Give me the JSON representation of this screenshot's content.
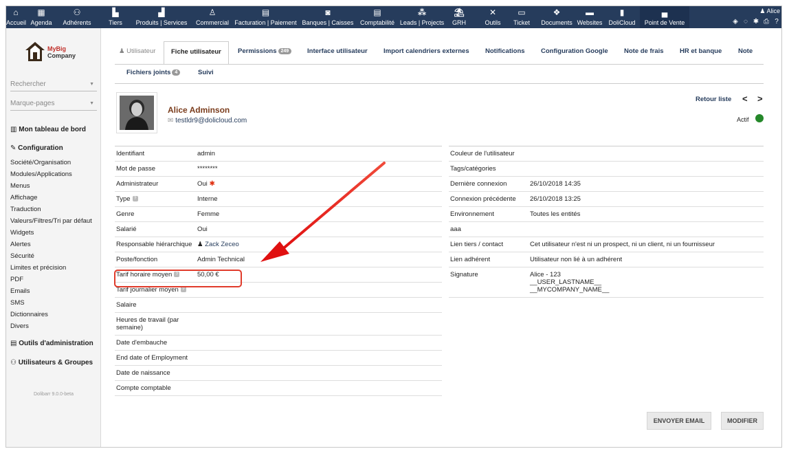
{
  "topmenu": [
    {
      "label": "Accueil",
      "icon": "home-icon"
    },
    {
      "label": "Agenda",
      "icon": "calendar-icon"
    },
    {
      "label": "Adhérents",
      "icon": "members-icon"
    },
    {
      "label": "Tiers",
      "icon": "companies-icon"
    },
    {
      "label": "Produits | Services",
      "icon": "products-icon"
    },
    {
      "label": "Commercial",
      "icon": "commercial-icon"
    },
    {
      "label": "Facturation | Paiement",
      "icon": "billing-icon"
    },
    {
      "label": "Banques | Caisses",
      "icon": "bank-icon"
    },
    {
      "label": "Comptabilité",
      "icon": "accounting-icon"
    },
    {
      "label": "Leads | Projects",
      "icon": "projects-icon"
    },
    {
      "label": "GRH",
      "icon": "hr-icon"
    },
    {
      "label": "Outils",
      "icon": "tools-icon"
    },
    {
      "label": "Ticket",
      "icon": "ticket-icon"
    },
    {
      "label": "Documents",
      "icon": "documents-icon"
    },
    {
      "label": "Websites",
      "icon": "websites-icon"
    },
    {
      "label": "DoliCloud",
      "icon": "dolicloud-icon"
    },
    {
      "label": "Point de Vente",
      "icon": "pos-icon"
    }
  ],
  "topright": {
    "user": "Alice"
  },
  "sidebar": {
    "logo_line1": "MyBig",
    "logo_line2": "Company",
    "search_placeholder": "Rechercher",
    "bookmarks_placeholder": "Marque-pages",
    "dashboard": "Mon tableau de bord",
    "config_title": "Configuration",
    "config_items": [
      "Société/Organisation",
      "Modules/Applications",
      "Menus",
      "Affichage",
      "Traduction",
      "Valeurs/Filtres/Tri par défaut",
      "Widgets",
      "Alertes",
      "Sécurité",
      "Limites et précision",
      "PDF",
      "Emails",
      "SMS",
      "Dictionnaires",
      "Divers"
    ],
    "admin_tools": "Outils d'administration",
    "users_groups": "Utilisateurs & Groupes",
    "version": "Dolibarr 9.0.0-beta"
  },
  "tabs": {
    "utilisateur": "Utilisateur",
    "fiche": "Fiche utilisateur",
    "permissions": "Permissions",
    "permissions_count": "249",
    "interface": "Interface utilisateur",
    "import": "Import calendriers externes",
    "notifications": "Notifications",
    "google": "Configuration Google",
    "frais": "Note de frais",
    "hr": "HR et banque",
    "note": "Note",
    "fichiers": "Fichiers joints",
    "fichiers_count": "4",
    "suivi": "Suivi"
  },
  "user": {
    "name": "Alice Adminson",
    "email": "testldr9@dolicloud.com",
    "status": "Actif"
  },
  "nav": {
    "retour": "Retour liste",
    "prev": "<",
    "next": ">"
  },
  "left_fields": [
    {
      "label": "Identifiant",
      "value": "admin"
    },
    {
      "label": "Mot de passe",
      "value": "********"
    },
    {
      "label": "Administrateur",
      "value": "Oui"
    },
    {
      "label": "Type",
      "value": "Interne"
    },
    {
      "label": "Genre",
      "value": "Femme"
    },
    {
      "label": "Salarié",
      "value": "Oui"
    },
    {
      "label": "Responsable hiérarchique",
      "value": "Zack Zeceo"
    },
    {
      "label": "Poste/fonction",
      "value": "Admin Technical"
    },
    {
      "label": "Tarif horaire moyen",
      "value": "50,00 €"
    },
    {
      "label": "Tarif journalier moyen",
      "value": ""
    },
    {
      "label": "Salaire",
      "value": ""
    },
    {
      "label": "Heures de travail (par semaine)",
      "value": ""
    },
    {
      "label": "Date d'embauche",
      "value": ""
    },
    {
      "label": "End date of Employment",
      "value": ""
    },
    {
      "label": "Date de naissance",
      "value": ""
    },
    {
      "label": "Compte comptable",
      "value": ""
    }
  ],
  "right_fields": [
    {
      "label": "Couleur de l'utilisateur",
      "value": ""
    },
    {
      "label": "Tags/catégories",
      "value": ""
    },
    {
      "label": "Dernière connexion",
      "value": "26/10/2018 14:35"
    },
    {
      "label": "Connexion précédente",
      "value": "26/10/2018 13:25"
    },
    {
      "label": "Environnement",
      "value": "Toutes les entités"
    },
    {
      "label": "aaa",
      "value": ""
    },
    {
      "label": "Lien tiers / contact",
      "value": "Cet utilisateur n'est ni un prospect, ni un client, ni un fournisseur"
    },
    {
      "label": "Lien adhérent",
      "value": "Utilisateur non lié à un adhérent"
    },
    {
      "label": "Signature",
      "value": "Alice - 123",
      "value_line2": "__USER_LASTNAME__",
      "value_line3": "__MYCOMPANY_NAME__"
    }
  ],
  "buttons": {
    "email": "ENVOYER EMAIL",
    "modify": "MODIFIER"
  },
  "colors": {
    "topbar": "#263c5c",
    "link": "#263c5c",
    "name": "#7a3c1c",
    "status": "#25882a",
    "highlight": "#e03a2a"
  }
}
